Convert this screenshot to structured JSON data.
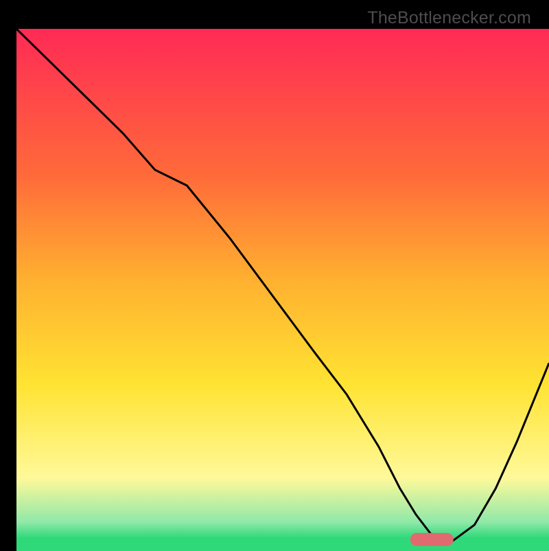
{
  "watermark": "TheBottlenecker.com",
  "colors": {
    "bg_black": "#000000",
    "grad_top": "#ff2a55",
    "grad_mid_upper": "#ff6a3a",
    "grad_mid": "#ffb030",
    "grad_mid_lower": "#ffe332",
    "grad_lower": "#fff99a",
    "grad_green_light": "#8fe8a8",
    "grad_green": "#2fd97a",
    "curve": "#000000",
    "marker_fill": "#e06a70",
    "marker_stroke": "#e06a70"
  },
  "chart_data": {
    "type": "line",
    "title": "",
    "xlabel": "",
    "ylabel": "",
    "xlim": [
      0,
      100
    ],
    "ylim": [
      0,
      100
    ],
    "legend": [],
    "series": [
      {
        "name": "bottleneck-curve",
        "x": [
          0,
          10,
          20,
          26,
          32,
          40,
          48,
          56,
          62,
          68,
          72,
          75,
          78,
          82,
          86,
          90,
          94,
          100
        ],
        "y": [
          100,
          90,
          80,
          73,
          70,
          60,
          49,
          38,
          30,
          20,
          12,
          7,
          3,
          2,
          5,
          12,
          21,
          36
        ]
      }
    ],
    "marker": {
      "x_center": 78,
      "x_halfwidth": 4,
      "y": 2.2
    },
    "gradient_bands": [
      {
        "offset": 0.0,
        "color_key": "grad_top"
      },
      {
        "offset": 0.28,
        "color_key": "grad_mid_upper"
      },
      {
        "offset": 0.48,
        "color_key": "grad_mid"
      },
      {
        "offset": 0.68,
        "color_key": "grad_mid_lower"
      },
      {
        "offset": 0.86,
        "color_key": "grad_lower"
      },
      {
        "offset": 0.945,
        "color_key": "grad_green_light"
      },
      {
        "offset": 0.975,
        "color_key": "grad_green"
      }
    ]
  }
}
